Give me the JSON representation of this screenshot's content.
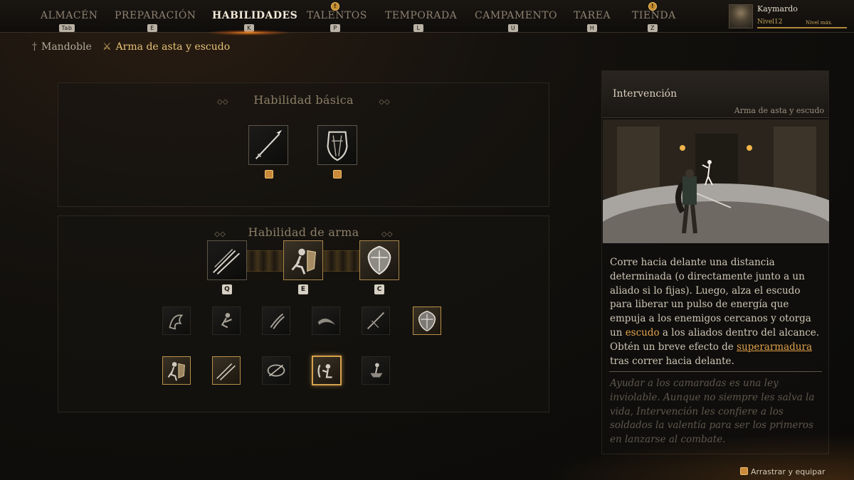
{
  "nav": {
    "tabs": [
      {
        "label": "ALMACÉN",
        "key": "Tab"
      },
      {
        "label": "PREPARACIÓN",
        "key": "E"
      },
      {
        "label": "HABILIDADES",
        "key": "K"
      },
      {
        "label": "TALENTOS",
        "key": "P"
      },
      {
        "label": "TEMPORADA",
        "key": "L"
      },
      {
        "label": "CAMPAMENTO",
        "key": "U"
      },
      {
        "label": "TAREA",
        "key": "H"
      },
      {
        "label": "TIENDA",
        "key": "Z"
      }
    ],
    "active_tab": "HABILIDADES",
    "notification_mark": "!"
  },
  "profile": {
    "name": "Kaymardo",
    "level": "Nivel12",
    "max_label": "Nivel máx."
  },
  "breadcrumbs": {
    "first": "Mandoble",
    "second": "Arma de asta y escudo"
  },
  "basic": {
    "title": "Habilidad básica",
    "skills": [
      "spear-icon",
      "tower-shield-icon"
    ]
  },
  "weapon": {
    "title": "Habilidad de arma",
    "equipped": [
      {
        "icon": "spear-volley-icon",
        "key": "Q"
      },
      {
        "icon": "shield-charge-icon",
        "key": "E"
      },
      {
        "icon": "round-shield-icon",
        "key": "C"
      }
    ],
    "row1": [
      "dragon-icon",
      "leap-strike-icon",
      "claw-slash-icon",
      "sweep-icon",
      "spear-thrust-icon",
      "round-shield-icon"
    ],
    "row2": [
      "shield-charge-icon",
      "spear-volley-icon",
      "whirl-icon",
      "intervention-icon",
      "shield-toss-icon"
    ]
  },
  "detail": {
    "title": "Intervención",
    "subtitle": "Arma de asta y escudo",
    "desc_1": "Corre hacia delante una distancia determinada (o directamente junto a un aliado si lo fijas). Luego, alza el escudo para liberar un pulso de energía que empuja a los enemigos cercanos y otorga un ",
    "desc_hl1": "escudo",
    "desc_2": " a los aliados dentro del alcance. Obtén un breve efecto de ",
    "desc_hl2": "superarmadura",
    "desc_3": " tras correr hacia delante.",
    "lore": "Ayudar a los camaradas es una ley inviolable. Aunque no siempre les salva la vida, Intervención les confiere a los soldados la valentía para ser los primeros en lanzarse al combate."
  },
  "actions": {
    "drag_equip": "Arrastrar y equipar"
  },
  "colors": {
    "accent": "#e2a24a",
    "active_tab": "#f2ead9",
    "inactive_tab": "#8d8170"
  }
}
